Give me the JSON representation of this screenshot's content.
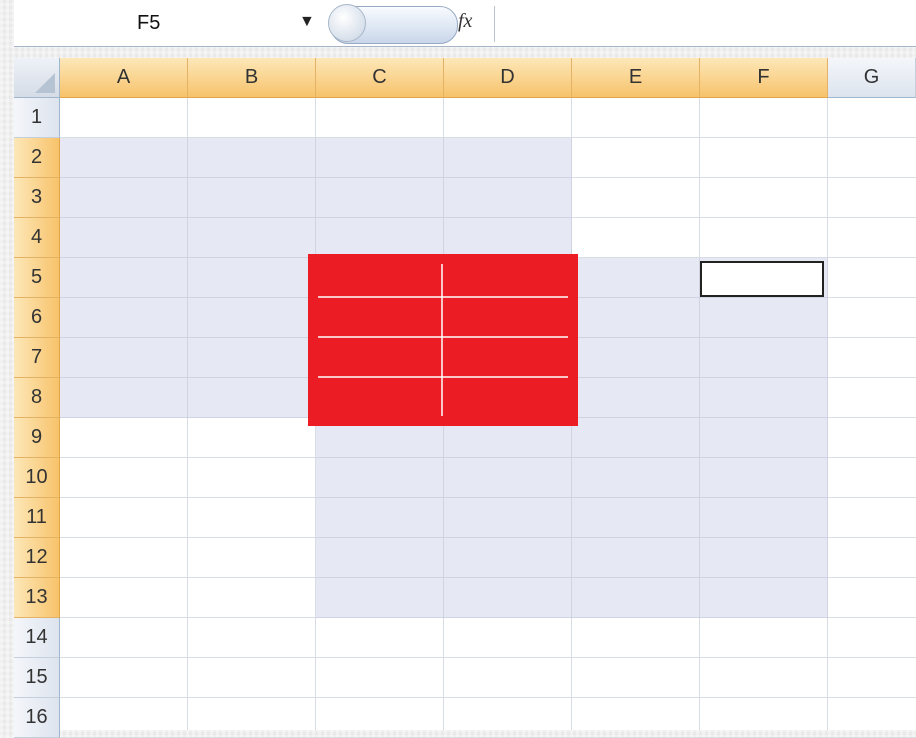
{
  "formula_bar": {
    "name_box_value": "F5",
    "fx_label": "fx",
    "formula_value": ""
  },
  "columns": [
    "A",
    "B",
    "C",
    "D",
    "E",
    "F",
    "G"
  ],
  "selected_columns": [
    "A",
    "B",
    "C",
    "D",
    "E",
    "F"
  ],
  "rows": [
    "1",
    "2",
    "3",
    "4",
    "5",
    "6",
    "7",
    "8",
    "9",
    "10",
    "11",
    "12",
    "13",
    "14",
    "15",
    "16"
  ],
  "selected_rows": [
    "2",
    "3",
    "4",
    "5",
    "6",
    "7",
    "8",
    "9",
    "10",
    "11",
    "12",
    "13"
  ],
  "active_cell": "F5",
  "highlighted_ranges": [
    "A2:D8",
    "C9:F13",
    "E5:F8"
  ],
  "shape": {
    "type": "rectangle",
    "color": "#ec1c24",
    "range": "C5:D8"
  },
  "colors": {
    "selected_header": "#f7c36b",
    "highlight": "#e6e9f3",
    "grid_line": "#d8dde4",
    "shape_red": "#ec1c24"
  },
  "icons": [
    "dropdown-arrow-icon",
    "fx-icon"
  ]
}
